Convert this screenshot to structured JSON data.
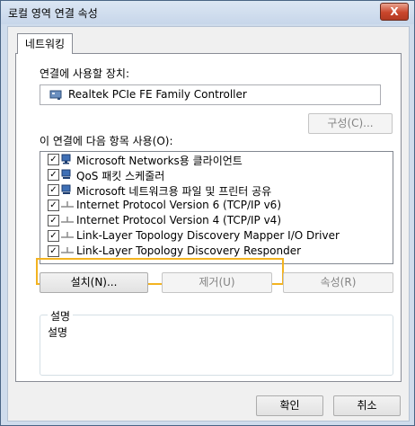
{
  "window": {
    "title": "로컬 영역 연결 속성",
    "close_label": "X"
  },
  "tabs": [
    {
      "label": "네트워킹"
    }
  ],
  "connect_using": {
    "label": "연결에 사용할 장치:",
    "device": "Realtek PCIe FE Family Controller",
    "device_icon": "network-adapter-icon"
  },
  "buttons": {
    "configure": "구성(C)...",
    "install": "설치(N)...",
    "uninstall": "제거(U)",
    "properties": "속성(R)",
    "ok": "확인",
    "cancel": "취소"
  },
  "items_label": "이 연결에 다음 항목 사용(O):",
  "items": [
    {
      "label": "Microsoft Networks용 클라이언트",
      "checked": true,
      "icon": "network-client-icon"
    },
    {
      "label": "QoS 패킷 스케줄러",
      "checked": true,
      "icon": "network-service-icon"
    },
    {
      "label": "Microsoft 네트워크용 파일 및 프린터 공유",
      "checked": true,
      "icon": "network-service-icon"
    },
    {
      "label": "Internet Protocol Version 6 (TCP/IP v6)",
      "checked": true,
      "icon": "protocol-icon"
    },
    {
      "label": "Internet Protocol Version 4 (TCP/IP v4)",
      "checked": true,
      "icon": "protocol-icon"
    },
    {
      "label": "Link-Layer Topology Discovery Mapper I/O Driver",
      "checked": true,
      "icon": "protocol-icon"
    },
    {
      "label": "Link-Layer Topology Discovery Responder",
      "checked": true,
      "icon": "protocol-icon"
    }
  ],
  "description": {
    "title": "설명",
    "text": "설명"
  },
  "colors": {
    "highlight": "#f3b320",
    "close_button": "#c9462c"
  }
}
